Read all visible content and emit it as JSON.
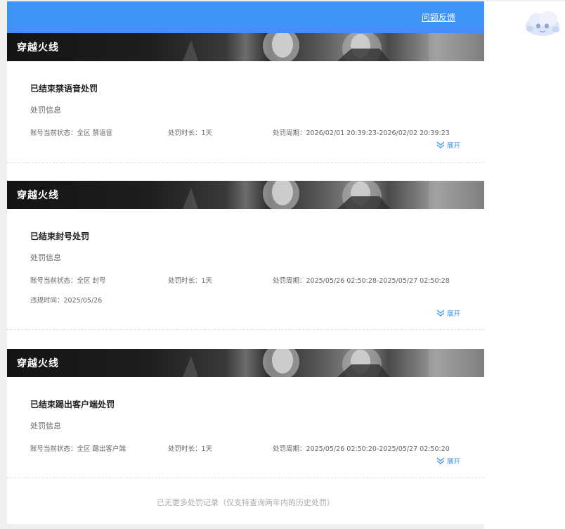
{
  "header": {
    "feedback_label": "问题反馈",
    "accent_color": "#3d94f6"
  },
  "mascot_icon": "cloud-mascot-icon",
  "records": [
    {
      "game": "穿越火线",
      "title": "已结束禁语音处罚",
      "subtitle": "处罚信息",
      "status": "账号当前状态：全区 禁语音",
      "duration": "处罚时长：1天",
      "period": "处罚周期：2026/02/01 20:39:23-2026/02/02 20:39:23",
      "expand_label": "展开"
    },
    {
      "game": "穿越火线",
      "title": "已结束封号处罚",
      "subtitle": "处罚信息",
      "status": "账号当前状态：全区 封号",
      "duration": "处罚时长：1天",
      "period": "处罚周期：2025/05/26 02:50:28-2025/05/27 02:50:28",
      "violation_time": "违规时间：2025/05/26",
      "expand_label": "展开"
    },
    {
      "game": "穿越火线",
      "title": "已结束踢出客户端处罚",
      "subtitle": "处罚信息",
      "status": "账号当前状态：全区 踢出客户端",
      "duration": "处罚时长：1天",
      "period": "处罚周期：2025/05/26 02:50:20-2025/05/27 02:50:20",
      "expand_label": "展开"
    }
  ],
  "footer_note": "已无更多处罚记录（仅支持查询两年内的历史处罚）"
}
